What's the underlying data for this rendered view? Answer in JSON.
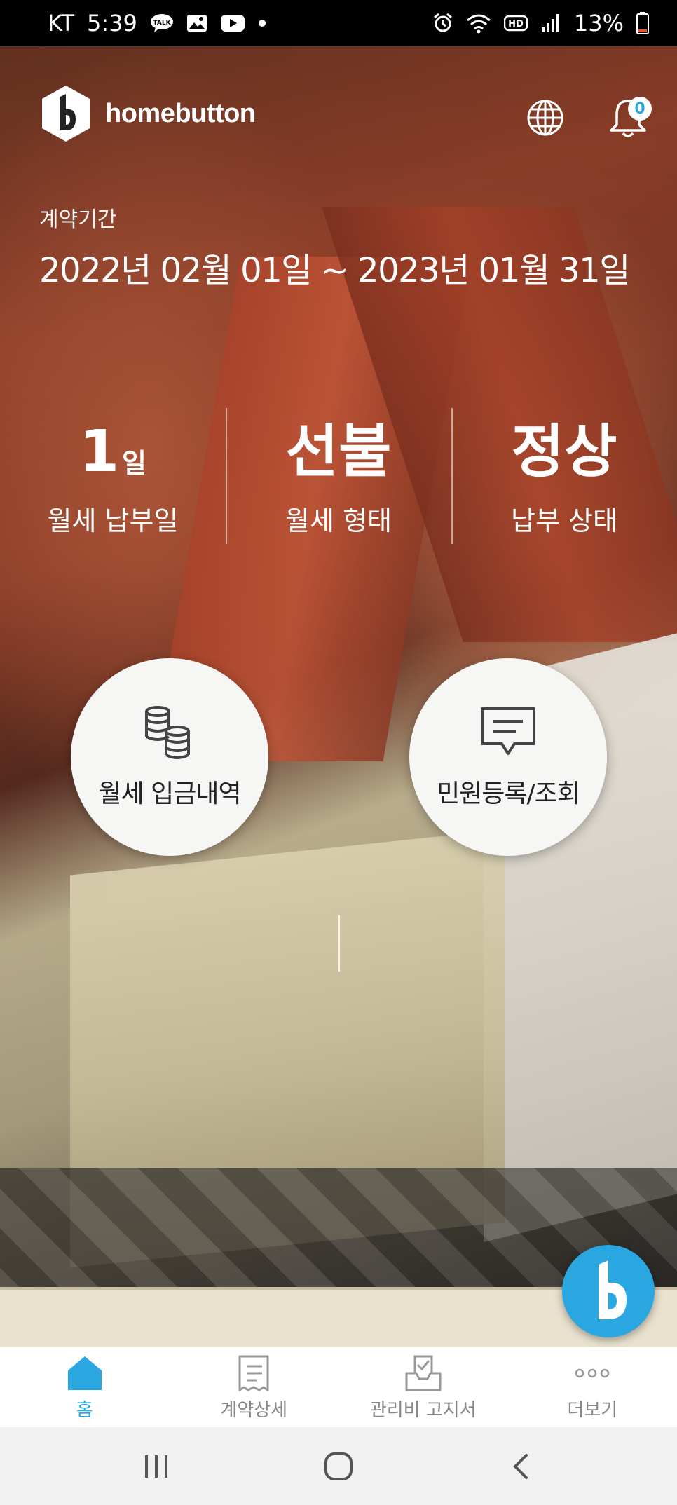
{
  "status_bar": {
    "carrier": "KT",
    "time": "5:39",
    "talk_badge": "TALK",
    "battery": "13%",
    "hd_label": "HD"
  },
  "header": {
    "logo_text": "homebutton",
    "notification_count": "0",
    "icons": [
      "globe-icon",
      "bell-icon"
    ]
  },
  "contract": {
    "label": "계약기간",
    "period": "2022년 02월 01일 ~ 2023년 01월 31일"
  },
  "stats": [
    {
      "value": "1",
      "unit": "일",
      "label": "월세 납부일"
    },
    {
      "value": "선불",
      "unit": "",
      "label": "월세 형태"
    },
    {
      "value": "정상",
      "unit": "",
      "label": "납부 상태"
    }
  ],
  "actions": {
    "rent_history": "월세 입금내역",
    "complaint": "민원등록/조회"
  },
  "bottom_nav": [
    {
      "label": "홈",
      "icon": "home-icon",
      "active": true
    },
    {
      "label": "계약상세",
      "icon": "document-icon",
      "active": false
    },
    {
      "label": "관리비 고지서",
      "icon": "inbox-check-icon",
      "active": false
    },
    {
      "label": "더보기",
      "icon": "more-icon",
      "active": false
    }
  ],
  "colors": {
    "accent": "#2aa6e0",
    "nav_inactive": "#888888",
    "status_bar": "#000000"
  }
}
